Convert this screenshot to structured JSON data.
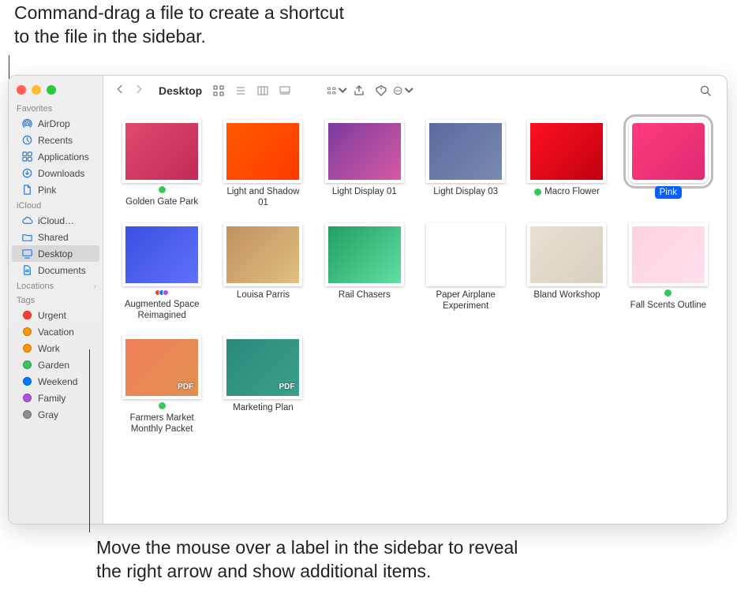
{
  "callouts": {
    "top": "Command-drag a file to create a shortcut to the file in the sidebar.",
    "bottom": "Move the mouse over a label in the sidebar to reveal the right arrow and show additional items."
  },
  "window": {
    "title": "Desktop"
  },
  "sidebar": {
    "sections": {
      "favorites": {
        "label": "Favorites"
      },
      "icloud": {
        "label": "iCloud"
      },
      "locations": {
        "label": "Locations"
      },
      "tags": {
        "label": "Tags"
      }
    },
    "favorites": [
      {
        "label": "AirDrop",
        "icon": "airdrop"
      },
      {
        "label": "Recents",
        "icon": "clock"
      },
      {
        "label": "Applications",
        "icon": "apps"
      },
      {
        "label": "Downloads",
        "icon": "download"
      },
      {
        "label": "Pink",
        "icon": "doc"
      }
    ],
    "icloud": [
      {
        "label": "iCloud…",
        "icon": "cloud"
      },
      {
        "label": "Shared",
        "icon": "folder"
      },
      {
        "label": "Desktop",
        "icon": "desktop",
        "selected": true
      },
      {
        "label": "Documents",
        "icon": "docfolder"
      }
    ],
    "tags": [
      {
        "label": "Urgent",
        "color": "#ff3b30"
      },
      {
        "label": "Vacation",
        "color": "#ff9500"
      },
      {
        "label": "Work",
        "color": "#ff9500"
      },
      {
        "label": "Garden",
        "color": "#34c759"
      },
      {
        "label": "Weekend",
        "color": "#007aff"
      },
      {
        "label": "Family",
        "color": "#af52de"
      },
      {
        "label": "Gray",
        "color": "#8e8e93"
      }
    ]
  },
  "items": [
    {
      "label": "Golden Gate Park",
      "tag": "#34c759",
      "bg": "linear-gradient(135deg,#e04a70,#c02a55)"
    },
    {
      "label": "Light and Shadow 01",
      "tag": null,
      "bg": "linear-gradient(135deg,#ff5a00,#ff3a00)"
    },
    {
      "label": "Light Display 01",
      "tag": null,
      "bg": "linear-gradient(135deg,#7b3aa0,#d65aa0)"
    },
    {
      "label": "Light Display 03",
      "tag": null,
      "bg": "linear-gradient(135deg,#5a6aa0,#7a8ab0)"
    },
    {
      "label": "Macro Flower",
      "tag": "#34c759",
      "bg": "linear-gradient(135deg,#ff1020,#c00010)"
    },
    {
      "label": "Pink",
      "tag": null,
      "bg": "linear-gradient(135deg,#ff3a80,#e02a70)",
      "selected": true
    },
    {
      "label": "Augmented Space Reimagined",
      "tag": "multi",
      "bg": "linear-gradient(135deg,#3a50e0,#6070ff)"
    },
    {
      "label": "Louisa Parris",
      "tag": null,
      "bg": "linear-gradient(135deg,#c09060,#e0c080)"
    },
    {
      "label": "Rail Chasers",
      "tag": null,
      "bg": "linear-gradient(135deg,#20a060,#60e0a0)"
    },
    {
      "label": "Paper Airplane Experiment",
      "tag": null,
      "bg": "#ffffff"
    },
    {
      "label": "Bland Workshop",
      "tag": null,
      "bg": "linear-gradient(135deg,#e8e0d0,#d8d0c0)"
    },
    {
      "label": "Fall Scents Outline",
      "tag": "#34c759",
      "bg": "linear-gradient(135deg,#ffd0e0,#ffe0ee)"
    },
    {
      "label": "Farmers Market Monthly Packet",
      "tag": "#34c759",
      "bg": "linear-gradient(135deg,#f0805a,#e09050)",
      "pdf": true
    },
    {
      "label": "Marketing Plan",
      "tag": null,
      "bg": "linear-gradient(135deg,#2a8a7a,#3aa08a)",
      "pdf": true
    }
  ]
}
